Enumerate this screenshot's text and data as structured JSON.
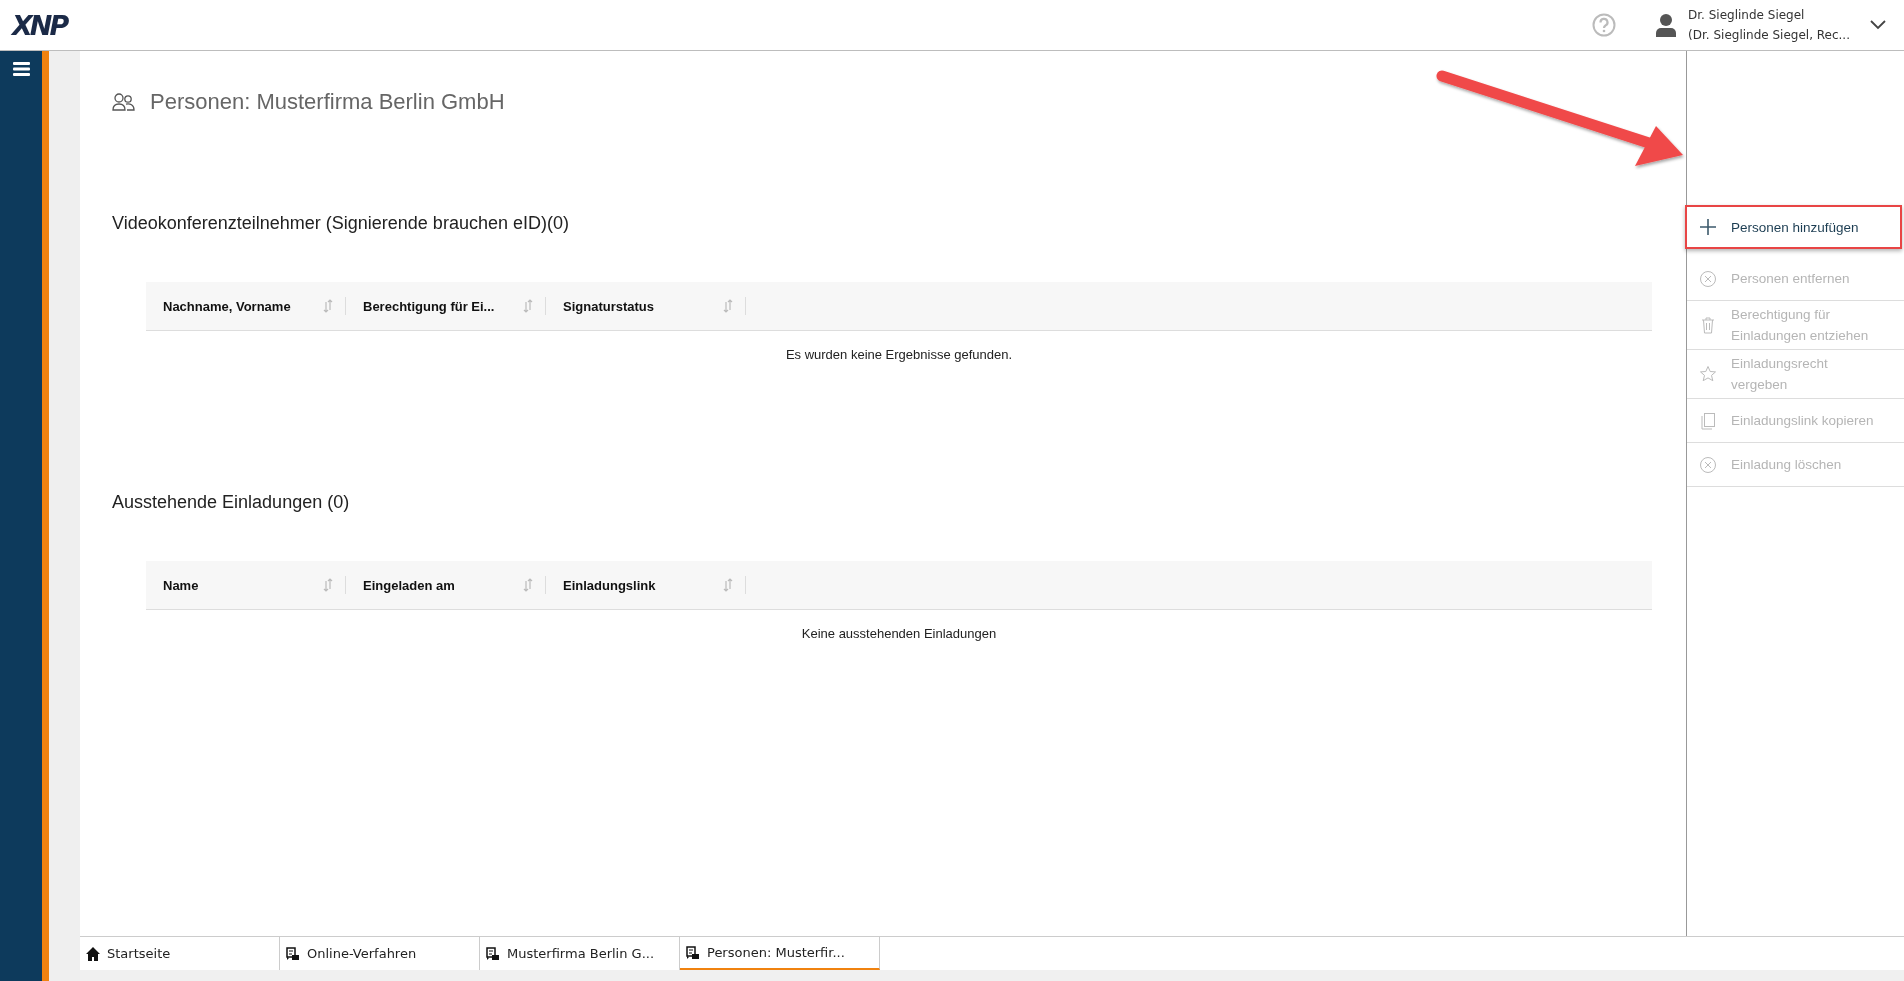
{
  "header": {
    "logo": "XNP",
    "user_name": "Dr. Sieglinde Siegel",
    "user_detail": "(Dr. Sieglinde Siegel, Rec..."
  },
  "page": {
    "title": "Personen: Musterfirma Berlin GmbH"
  },
  "sections": [
    {
      "heading": "Videokonferenzteilnehmer (Signierende brauchen eID)(0)",
      "columns": [
        "Nachname, Vorname",
        "Berechtigung für Ei...",
        "Signaturstatus"
      ],
      "empty_message": "Es wurden keine Ergebnisse gefunden."
    },
    {
      "heading": "Ausstehende Einladungen (0)",
      "columns": [
        "Name",
        "Eingeladen am",
        "Einladungslink"
      ],
      "empty_message": "Keine ausstehenden Einladungen"
    }
  ],
  "actions": [
    {
      "label": "Personen hinzufügen",
      "kind": "add",
      "disabled": false,
      "highlighted": true
    },
    {
      "label": "Personen entfernen",
      "kind": "remove",
      "disabled": true,
      "highlighted": false
    },
    {
      "label": "Berechtigung für Einladungen entziehen",
      "kind": "trash",
      "disabled": true,
      "highlighted": false
    },
    {
      "label": "Einladungsrecht vergeben",
      "kind": "star",
      "disabled": true,
      "highlighted": false
    },
    {
      "label": "Einladungslink kopieren",
      "kind": "copy",
      "disabled": true,
      "highlighted": false
    },
    {
      "label": "Einladung löschen",
      "kind": "remove",
      "disabled": true,
      "highlighted": false
    }
  ],
  "tabs": [
    {
      "label": "Startseite",
      "kind": "home",
      "selected": false
    },
    {
      "label": "Online-Verfahren",
      "kind": "process",
      "selected": false
    },
    {
      "label": "Musterfirma Berlin G...",
      "kind": "process",
      "selected": false
    },
    {
      "label": "Personen: Musterfir...",
      "kind": "process",
      "selected": true
    }
  ]
}
